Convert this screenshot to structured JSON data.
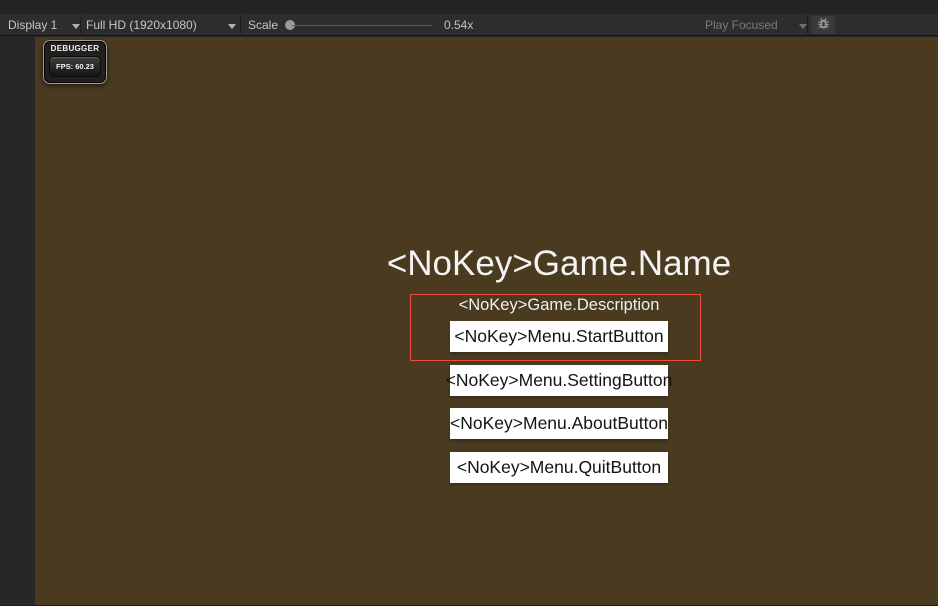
{
  "toolbar": {
    "display_dropdown": "Display 1",
    "resolution_dropdown": "Full HD (1920x1080)",
    "scale_label": "Scale",
    "scale_value": "0.54x",
    "play_focused_label": "Play Focused"
  },
  "debugger_panel": {
    "title": "DEBUGGER",
    "fps_label": "FPS: 60.23"
  },
  "game": {
    "title": "<NoKey>Game.Name",
    "description": "<NoKey>Game.Description",
    "buttons": [
      {
        "label": "<NoKey>Menu.StartButton",
        "selected": true
      },
      {
        "label": "<NoKey>Menu.SettingButton",
        "selected": false
      },
      {
        "label": "<NoKey>Menu.AboutButton",
        "selected": false
      },
      {
        "label": "<NoKey>Menu.QuitButton",
        "selected": false
      }
    ]
  },
  "colors": {
    "game_background": "#493a20",
    "selection_outline": "#ee4b3c",
    "toolbar_bg": "#2d2d2d",
    "tab_strip_bg": "#232323",
    "button_bg": "#ffffff",
    "button_text": "#141414"
  }
}
